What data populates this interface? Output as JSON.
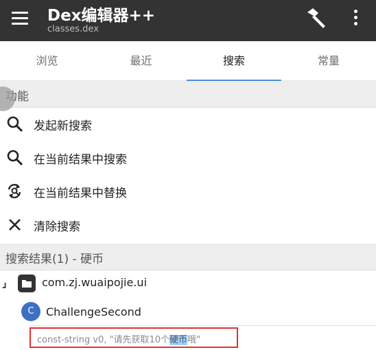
{
  "app_bar": {
    "title": "Dex编辑器++",
    "subtitle": "classes.dex",
    "menu_icon": "hamburger-menu-icon",
    "build_icon": "hammer-icon",
    "more_icon": "more-vertical-icon",
    "background_color": "#333333"
  },
  "tabs": [
    {
      "label": "浏览",
      "active": false
    },
    {
      "label": "最近",
      "active": false
    },
    {
      "label": "搜索",
      "active": true
    },
    {
      "label": "常量",
      "active": false
    }
  ],
  "accent_color": "#4a90d9",
  "functions": {
    "header": "功能",
    "items": [
      {
        "label": "发起新搜索",
        "icon": "search-icon"
      },
      {
        "label": "在当前结果中搜索",
        "icon": "search-icon"
      },
      {
        "label": "在当前结果中替换",
        "icon": "replace-icon"
      },
      {
        "label": "清除搜索",
        "icon": "close-icon"
      }
    ]
  },
  "results": {
    "header": "搜索结果(1) - 硬币",
    "package": {
      "name": "com.zj.wuaipojie.ui",
      "icon": "folder-icon",
      "expand_marker": "┛"
    },
    "class": {
      "name": "ChallengeSecond",
      "badge": "C"
    },
    "match": {
      "prefix": "const-string v0, \"请先获取10个",
      "highlight": "硬币",
      "suffix": "哦\"",
      "outline_color": "#e03030"
    }
  }
}
